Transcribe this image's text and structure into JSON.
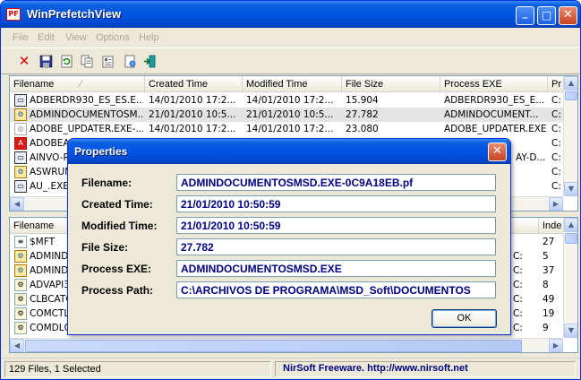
{
  "window": {
    "title": "WinPrefetchView",
    "app_icon_text": "PF",
    "buttons": {
      "minimize": "_",
      "maximize": "□",
      "close": "✕"
    }
  },
  "menu": [
    "File",
    "Edit",
    "View",
    "Options",
    "Help"
  ],
  "toolbar": [
    "delete-icon",
    "save-icon",
    "refresh-icon",
    "copy-icon",
    "properties-icon",
    "html-report-icon",
    "exit-icon"
  ],
  "top_list": {
    "columns": [
      "Filename",
      "Created Time",
      "Modified Time",
      "File Size",
      "Process EXE",
      "Pr"
    ],
    "rows": [
      {
        "filename": "ADBERDR930_ES_ES.E...",
        "created": "14/01/2010 17:2...",
        "modified": "14/01/2010 17:2...",
        "size": "15.904",
        "exe": "ADBERDR930_ES_E...",
        "pr": "C:"
      },
      {
        "filename": "ADMINDOCUMENTOSM...",
        "created": "21/01/2010 10:5...",
        "modified": "21/01/2010 10:5...",
        "size": "27.782",
        "exe": "ADMINDOCUMENT...",
        "pr": "C:"
      },
      {
        "filename": "ADOBE_UPDATER.EXE-...",
        "created": "14/01/2010 17:2...",
        "modified": "14/01/2010 17:2...",
        "size": "23.080",
        "exe": "ADOBE_UPDATER.EXE",
        "pr": "C:"
      },
      {
        "filename": "ADOBEAR",
        "created": "",
        "modified": "",
        "size": "",
        "exe": "",
        "pr": "C:"
      },
      {
        "filename": "AINVO-RU",
        "created": "",
        "modified": "",
        "size": "",
        "exe": "AY-D...",
        "pr": "C:"
      },
      {
        "filename": "ASWRUN",
        "created": "",
        "modified": "",
        "size": "",
        "exe": "",
        "pr": "C:"
      },
      {
        "filename": "AU_.EXE-",
        "created": "",
        "modified": "",
        "size": "",
        "exe": "",
        "pr": "C:"
      }
    ]
  },
  "bottom_list": {
    "columns": [
      "Filename",
      "Inde"
    ],
    "rows": [
      {
        "filename": "$MFT",
        "index": "27"
      },
      {
        "filename": "ADMINDO",
        "index": "5"
      },
      {
        "filename": "ADMINDO",
        "index": "37"
      },
      {
        "filename": "ADVAPI32",
        "index": "8"
      },
      {
        "filename": "CLBCATQ",
        "index": "49"
      },
      {
        "filename": "COMCTL3",
        "index": "19"
      },
      {
        "filename": "COMDLG3",
        "index": "9"
      }
    ],
    "edge_values": [
      "C:",
      "C:",
      "C:",
      "C:",
      "C:",
      "C:",
      "C:"
    ]
  },
  "status": {
    "count": "129 Files, 1 Selected",
    "credit": "NirSoft Freeware.  http://www.nirsoft.net"
  },
  "dialog": {
    "title": "Properties",
    "close": "✕",
    "fields": [
      {
        "label": "Filename:",
        "value": "ADMINDOCUMENTOSMSD.EXE-0C9A18EB.pf"
      },
      {
        "label": "Created Time:",
        "value": "21/01/2010 10:50:59"
      },
      {
        "label": "Modified Time:",
        "value": "21/01/2010 10:50:59"
      },
      {
        "label": "File Size:",
        "value": "27.782"
      },
      {
        "label": "Process EXE:",
        "value": "ADMINDOCUMENTOSMSD.EXE"
      },
      {
        "label": "Process Path:",
        "value": "C:\\ARCHIVOS DE PROGRAMA\\MSD_Soft\\DOCUMENTOS"
      }
    ],
    "ok": "OK"
  }
}
